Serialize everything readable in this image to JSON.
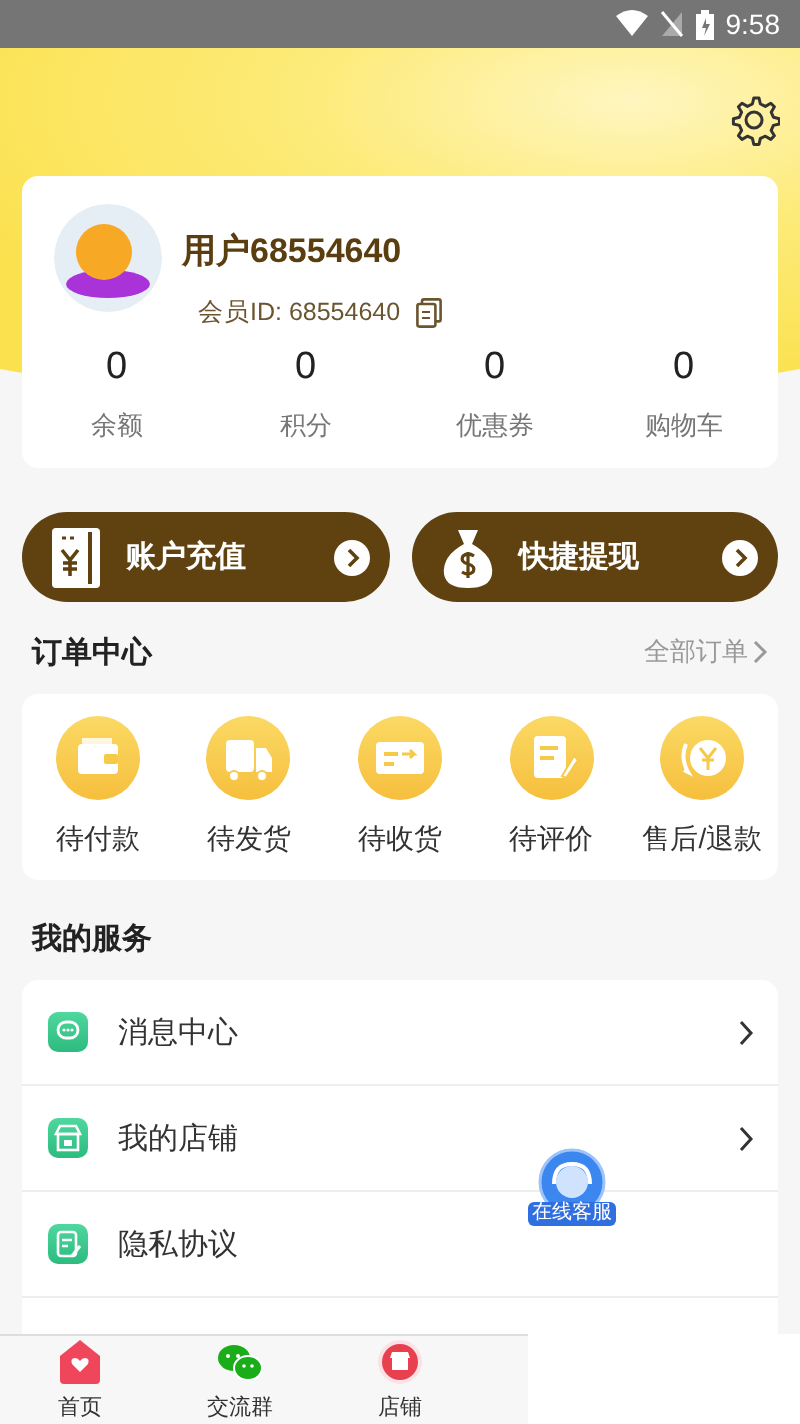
{
  "status_bar": {
    "time": "9:58"
  },
  "profile": {
    "name": "用户68554640",
    "member_id": "会员ID: 68554640",
    "stats": [
      {
        "value": "0",
        "label": "余额"
      },
      {
        "value": "0",
        "label": "积分"
      },
      {
        "value": "0",
        "label": "优惠券"
      },
      {
        "value": "0",
        "label": "购物车"
      }
    ]
  },
  "actions": [
    {
      "label": "账户充值",
      "kind": "recharge"
    },
    {
      "label": "快捷提现",
      "kind": "withdraw"
    }
  ],
  "orders": {
    "title": "订单中心",
    "all_link": "全部订单",
    "items": [
      {
        "label": "待付款",
        "kind": "wallet"
      },
      {
        "label": "待发货",
        "kind": "truck"
      },
      {
        "label": "待收货",
        "kind": "card"
      },
      {
        "label": "待评价",
        "kind": "note"
      },
      {
        "label": "售后/退款",
        "kind": "refund"
      }
    ]
  },
  "services": {
    "title": "我的服务",
    "items": [
      {
        "label": "消息中心",
        "kind": "message",
        "arrow": true
      },
      {
        "label": "我的店铺",
        "kind": "shop",
        "arrow": true
      },
      {
        "label": "隐私协议",
        "kind": "privacy",
        "arrow": false
      }
    ]
  },
  "float_badge": {
    "label": "在线客服"
  },
  "tab_bar": [
    {
      "label": "首页",
      "kind": "home"
    },
    {
      "label": "交流群",
      "kind": "chat"
    },
    {
      "label": "店铺",
      "kind": "store"
    }
  ]
}
